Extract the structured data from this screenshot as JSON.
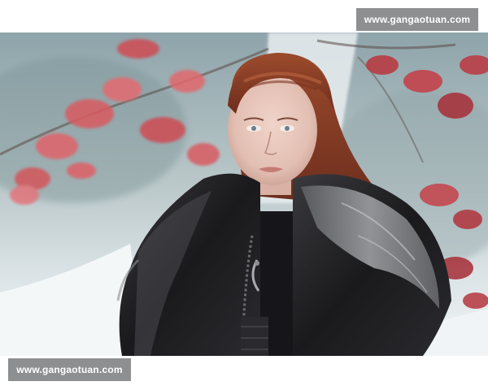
{
  "watermark": {
    "top_text": "www.gangaotuan.com",
    "bottom_text": "www.gangaotuan.com"
  },
  "photo": {
    "subject": "portrait-with-fur-cloak",
    "colors": {
      "background_mist": "#b9c6c8",
      "snow": "#eef2f4",
      "leaves": "#c94a4f",
      "hair": "#8b3d26",
      "skin": "#e7c7bc",
      "fur_dark": "#1c1c1f",
      "fur_light": "#8d8f93",
      "watermark_bg": "#8d8f91"
    }
  }
}
